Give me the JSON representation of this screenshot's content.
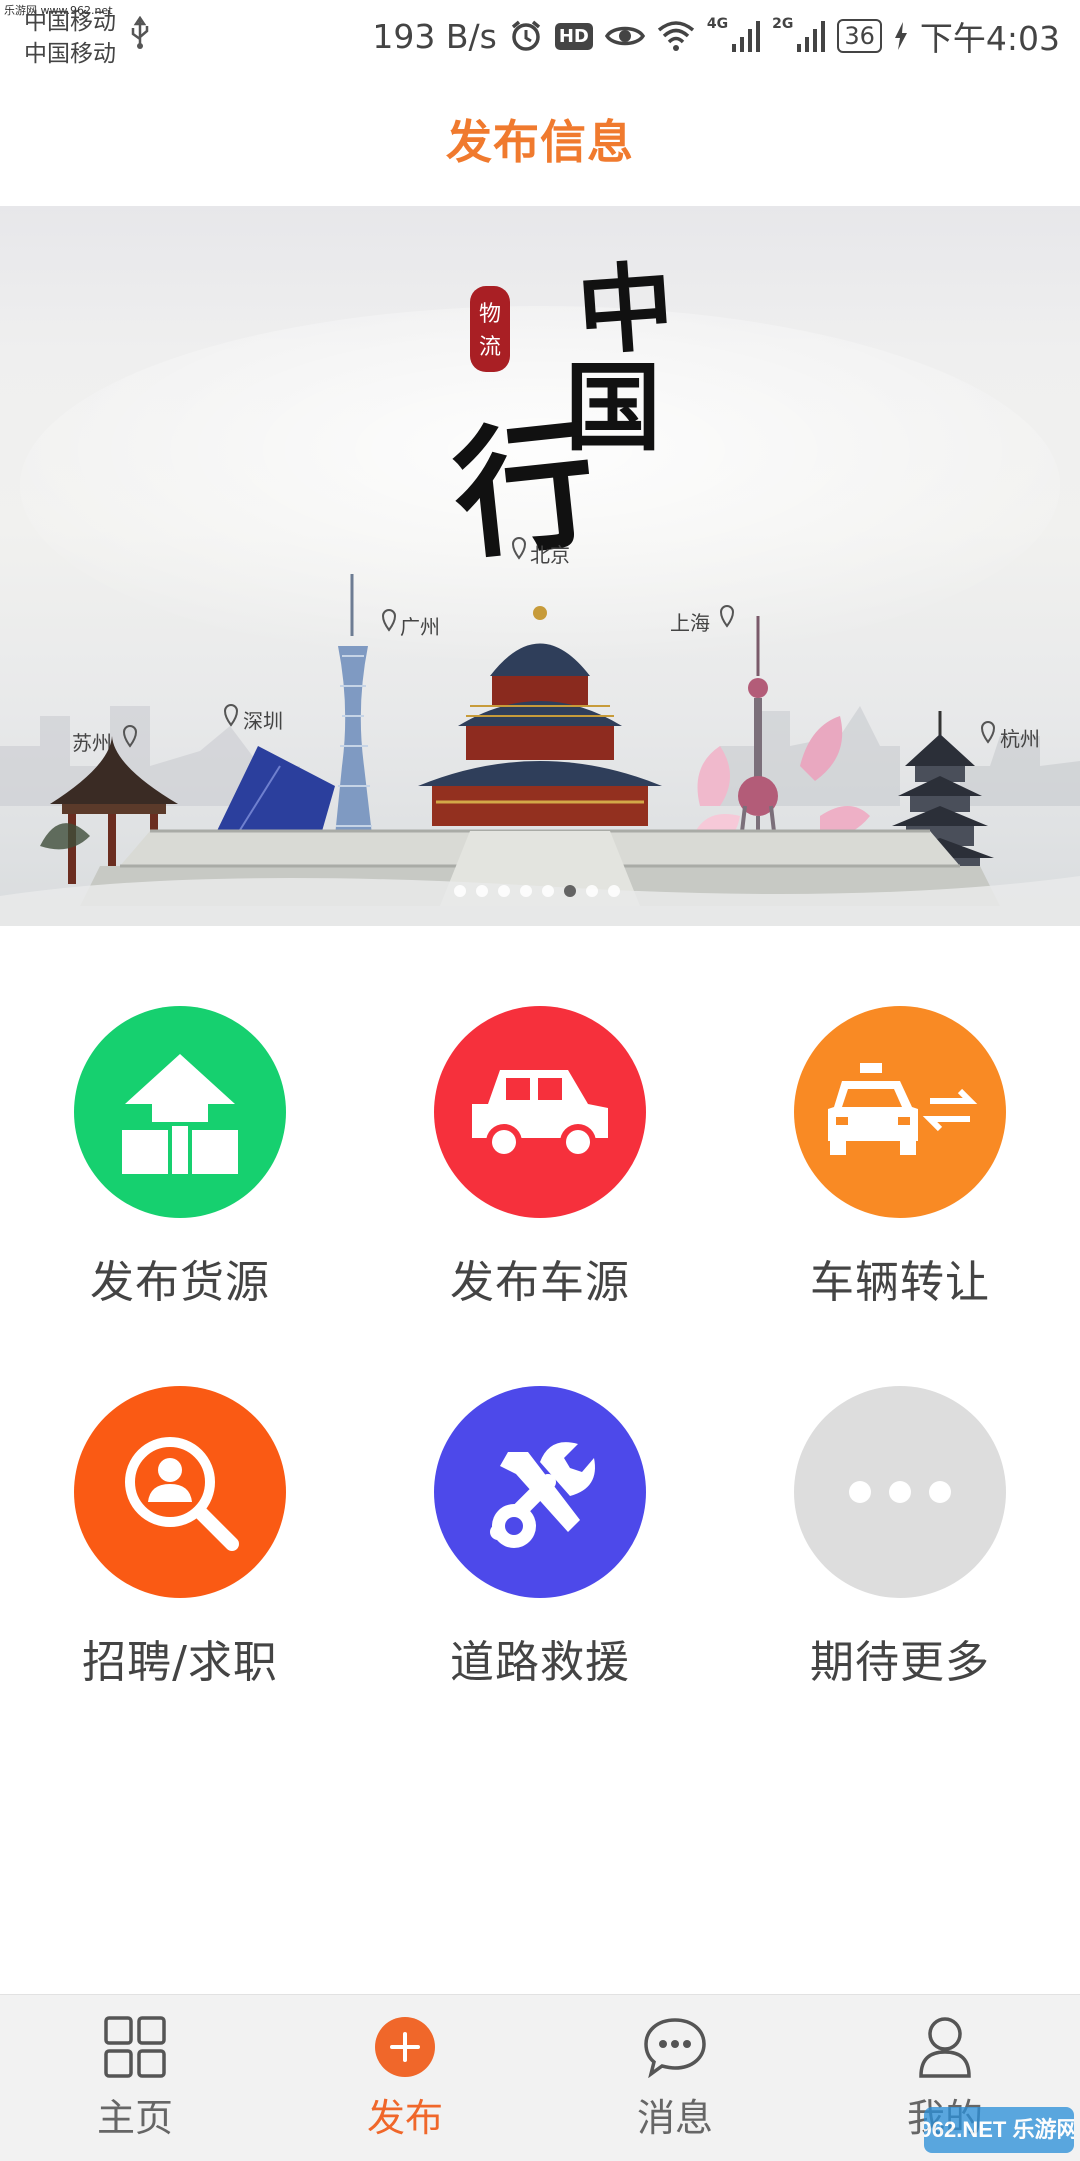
{
  "status_bar": {
    "watermark": "乐游网 www.962.net",
    "carrier_1": "中国移动",
    "carrier_2": "中国移动",
    "net_speed": "193 B/s",
    "net_type_1": "4G",
    "net_type_2": "2G",
    "battery": "36",
    "time": "下午4:03",
    "icons": [
      "usb-icon",
      "alarm-icon",
      "hd-icon",
      "eye-icon",
      "wifi-icon",
      "signal-icon",
      "signal-icon",
      "charging-icon"
    ]
  },
  "header": {
    "title": "发布信息",
    "accent": "#f07a2e"
  },
  "banner": {
    "calligraphy": "中国行",
    "seal": "物流",
    "cities": [
      "北京",
      "广州",
      "深圳",
      "苏州",
      "上海",
      "杭州"
    ],
    "indicator_count": 8,
    "indicator_active": 5
  },
  "actions": [
    {
      "label": "发布货源",
      "icon": "house-icon",
      "color": "#16d06f"
    },
    {
      "label": "发布车源",
      "icon": "truck-icon",
      "color": "#f6303c"
    },
    {
      "label": "车辆转让",
      "icon": "taxi-transfer-icon",
      "color": "#f98a24"
    },
    {
      "label": "招聘/求职",
      "icon": "search-person-icon",
      "color": "#fa5a14"
    },
    {
      "label": "道路救援",
      "icon": "tools-icon",
      "color": "#4d49ea"
    },
    {
      "label": "期待更多",
      "icon": "more-icon",
      "color": "#dddddd"
    }
  ],
  "tabs": [
    {
      "label": "主页",
      "icon": "grid-icon",
      "active": false
    },
    {
      "label": "发布",
      "icon": "plus-icon",
      "active": true
    },
    {
      "label": "消息",
      "icon": "chat-icon",
      "active": false
    },
    {
      "label": "我的",
      "icon": "user-icon",
      "active": false
    }
  ],
  "footer_watermark": "962.NET 乐游网"
}
